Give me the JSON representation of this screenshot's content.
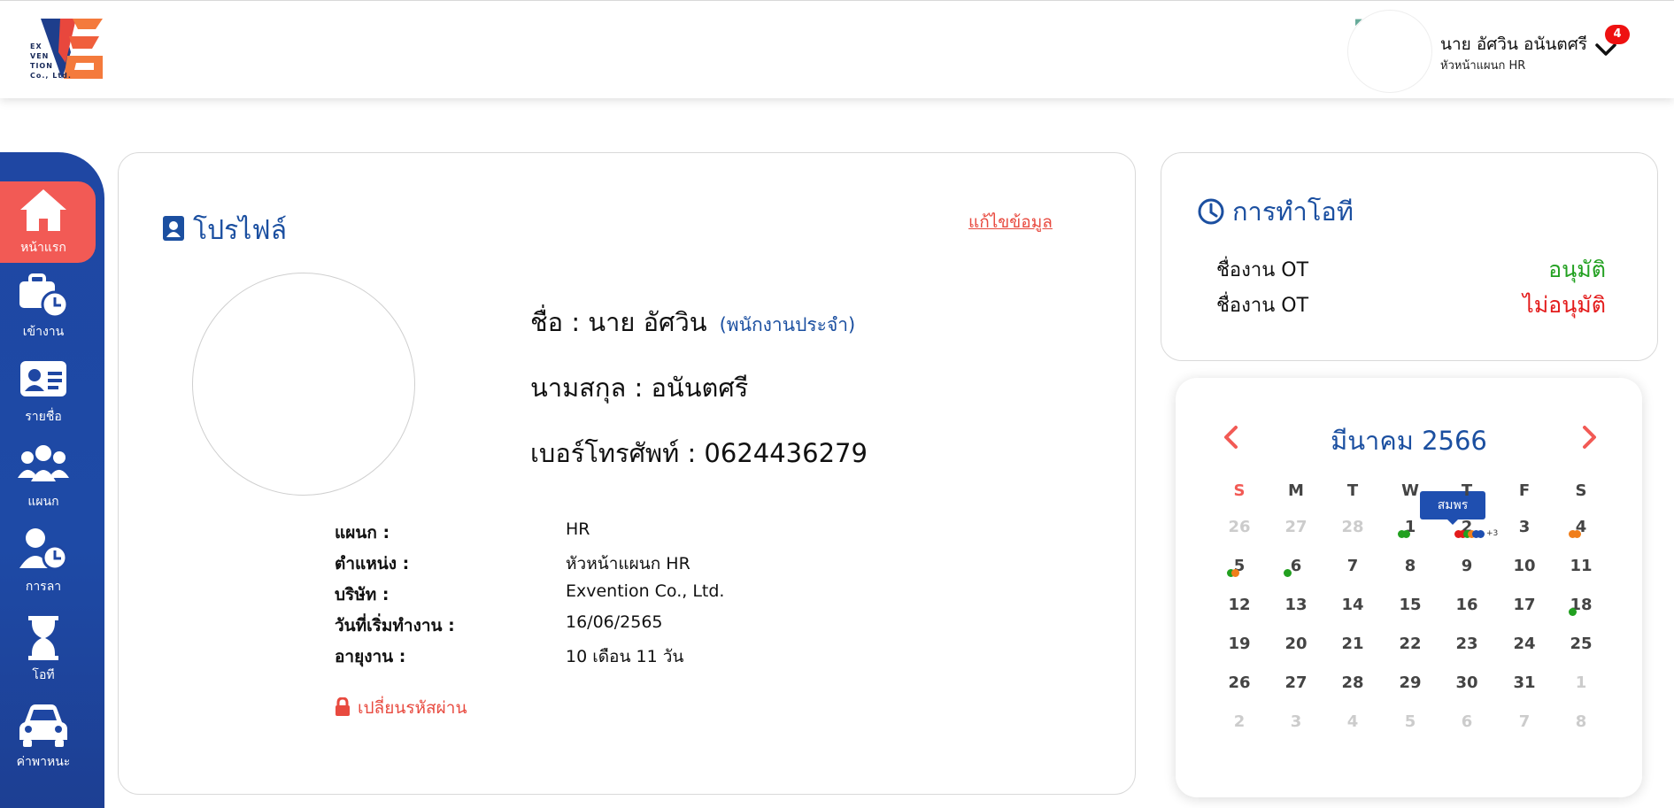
{
  "header": {
    "logo_text": "EX\nVEN\nTION\nCo., Ltd.",
    "user_name": "นาย อัศวิน อนันตศรี",
    "user_role": "หัวหน้าแผนก HR",
    "notification_count": "4"
  },
  "sidebar": {
    "items": [
      {
        "label": "หน้าแรก",
        "icon": "home-icon",
        "active": true
      },
      {
        "label": "เข้างาน",
        "icon": "briefcase-clock-icon"
      },
      {
        "label": "รายชื่อ",
        "icon": "id-card-icon"
      },
      {
        "label": "แผนก",
        "icon": "users-icon"
      },
      {
        "label": "การลา",
        "icon": "user-clock-icon"
      },
      {
        "label": "โอที",
        "icon": "hourglass-icon"
      },
      {
        "label": "ค่าพาหนะ",
        "icon": "car-icon"
      }
    ]
  },
  "profile": {
    "title": "โปรไฟล์",
    "edit_label": "แก้ไขข้อมูล",
    "name_line": "ชื่อ : นาย อัศวิน",
    "employee_type": "(พนักงานประจำ)",
    "surname_line": "นามสกุล : อนันตศรี",
    "phone_line": "เบอร์โทรศัพท์ : 0624436279",
    "fields": [
      {
        "label": "แผนก :",
        "value": "HR"
      },
      {
        "label": "ตำแหน่ง :",
        "value": "หัวหน้าแผนก HR"
      },
      {
        "label": "บริษัท :",
        "value": "Exvention Co., Ltd."
      },
      {
        "label": "วันที่เริ่มทำงาน :",
        "value": "16/06/2565"
      },
      {
        "label": "อายุงาน :",
        "value": "10 เดือน 11 วัน"
      }
    ],
    "change_password_label": "เปลี่ยนรหัสผ่าน"
  },
  "ot": {
    "title": "การทำโอที",
    "rows": [
      {
        "name": "ชื่องาน OT",
        "status": "อนุมัติ",
        "color": "#22a020"
      },
      {
        "name": "ชื่องาน OT",
        "status": "ไม่อนุมัติ",
        "color": "#e31b1b"
      }
    ]
  },
  "calendar": {
    "month_year": "มีนาคม  2566",
    "weekdays": [
      "S",
      "M",
      "T",
      "W",
      "T",
      "F",
      "S"
    ],
    "weeks": [
      [
        "26",
        "27",
        "28",
        "1",
        "2",
        "3",
        "4"
      ],
      [
        "5",
        "6",
        "7",
        "8",
        "9",
        "10",
        "11"
      ],
      [
        "12",
        "13",
        "14",
        "15",
        "16",
        "17",
        "18"
      ],
      [
        "19",
        "20",
        "21",
        "22",
        "23",
        "24",
        "25"
      ],
      [
        "26",
        "27",
        "28",
        "29",
        "30",
        "31",
        "1"
      ],
      [
        "2",
        "3",
        "4",
        "5",
        "6",
        "7",
        "8"
      ]
    ],
    "tooltip": "สมพร",
    "more_label": "+3",
    "colors": {
      "green": "#22a020",
      "orange": "#f07e1a",
      "red": "#e31b1b",
      "blue": "#1f4fb0",
      "accent": "#f25a55"
    }
  }
}
